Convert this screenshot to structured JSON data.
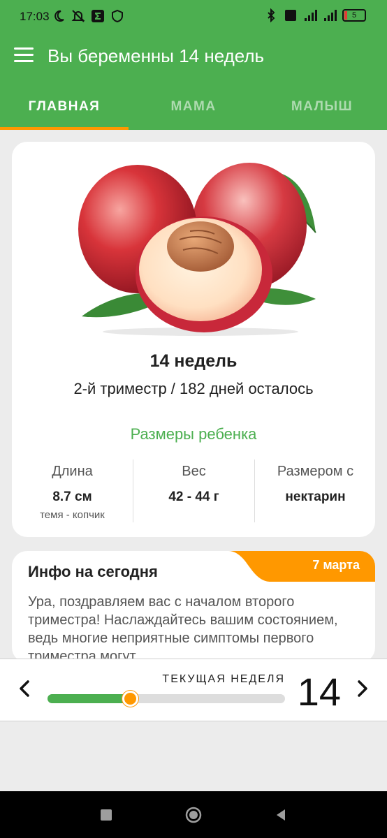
{
  "status_bar": {
    "time": "17:03",
    "battery": "5"
  },
  "app_bar": {
    "title": "Вы беременны 14 недель"
  },
  "tabs": [
    {
      "label": "ГЛАВНАЯ",
      "active": true
    },
    {
      "label": "МАМА",
      "active": false
    },
    {
      "label": "МАЛЫШ",
      "active": false
    }
  ],
  "main_card": {
    "fruit_image": "nectarine",
    "weeks": "14 недель",
    "trimester": "2-й триместр / 182 дней осталось",
    "sizes_title": "Размеры ребенка",
    "stats": [
      {
        "label": "Длина",
        "value": "8.7 см",
        "sub": "темя - копчик"
      },
      {
        "label": "Вес",
        "value": "42 - 44 г",
        "sub": ""
      },
      {
        "label": "Размером с",
        "value": "нектарин",
        "sub": ""
      }
    ]
  },
  "info_card": {
    "title": "Инфо на сегодня",
    "date": "7 марта",
    "text": "Ура, поздравляем вас с началом второго триместра! Наслаждайтесь вашим состоянием, ведь многие неприятные симптомы первого триместра могут"
  },
  "week_selector": {
    "label": "ТЕКУЩАЯ НЕДЕЛЯ",
    "week": "14",
    "progress_fraction": 0.35
  },
  "colors": {
    "primary": "#4caf50",
    "accent": "#ff9800"
  }
}
